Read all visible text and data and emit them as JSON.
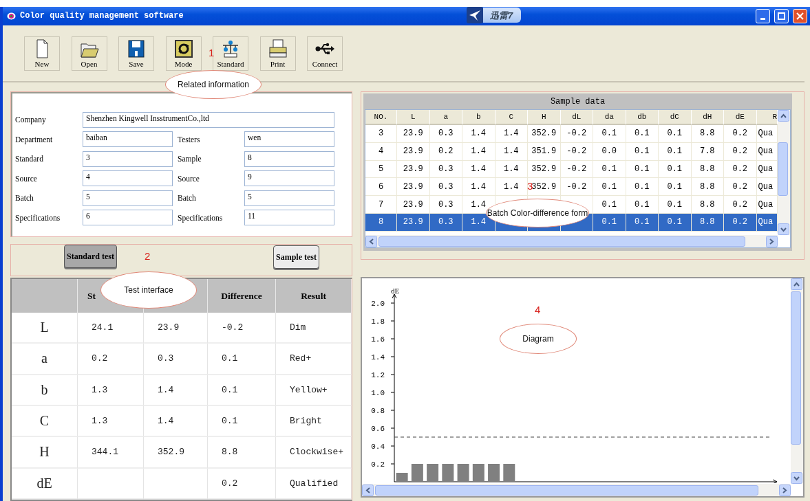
{
  "window": {
    "title": "Color quality management software"
  },
  "title_badge": {
    "label": "迅雷7"
  },
  "toolbar": [
    {
      "kind": "new",
      "label": "New"
    },
    {
      "kind": "open",
      "label": "Open"
    },
    {
      "kind": "save",
      "label": "Save"
    },
    {
      "kind": "mode",
      "label": "Mode"
    },
    {
      "kind": "standard",
      "label": "Standard"
    },
    {
      "kind": "print",
      "label": "Print"
    },
    {
      "kind": "connect",
      "label": "Connect"
    }
  ],
  "info": {
    "rows": [
      [
        {
          "label": "Company",
          "value": "Shenzhen Kingwell InsstrumentCo.,ltd"
        }
      ],
      [
        {
          "label": "Department",
          "value": "baiban"
        },
        {
          "label": "Testers",
          "value": "wen"
        }
      ],
      [
        {
          "label": "Standard",
          "value": "3"
        },
        {
          "label": "Sample",
          "value": "8"
        }
      ],
      [
        {
          "label": "Source",
          "value": "4"
        },
        {
          "label": "Source",
          "value": "9"
        }
      ],
      [
        {
          "label": "Batch",
          "value": "5"
        },
        {
          "label": "Batch",
          "value": "5"
        }
      ],
      [
        {
          "label": "Specifications",
          "value": "6"
        },
        {
          "label": "Specifications",
          "value": "11"
        }
      ]
    ]
  },
  "test_buttons": [
    {
      "label": "Standard test",
      "selected": true
    },
    {
      "label": "Sample test",
      "selected": false
    }
  ],
  "test_table": {
    "columns": [
      {
        "kind": "blank"
      },
      {
        "kind": "text",
        "label": "St"
      },
      {
        "kind": "blank"
      },
      {
        "kind": "text",
        "label": "Difference"
      },
      {
        "kind": "text",
        "label": "Result"
      }
    ],
    "rows": [
      [
        "L",
        "24.1",
        "23.9",
        "-0.2",
        "Dim"
      ],
      [
        "a",
        "0.2",
        "0.3",
        "0.1",
        "Red+"
      ],
      [
        "b",
        "1.3",
        "1.4",
        "0.1",
        "Yellow+"
      ],
      [
        "C",
        "1.3",
        "1.4",
        "0.1",
        "Bright"
      ],
      [
        "H",
        "344.1",
        "352.9",
        "8.8",
        "Clockwise+"
      ],
      [
        "dE",
        null,
        null,
        "0.2",
        "Qualified"
      ]
    ]
  },
  "sample_data": {
    "title": "Sample data",
    "columns": [
      "NO.",
      "L",
      "a",
      "b",
      "C",
      "H",
      "dL",
      "da",
      "db",
      "dC",
      "dH",
      "dE",
      "R"
    ],
    "rows": [
      {
        "selected": false,
        "cells": [
          "3",
          "23.9",
          "0.3",
          "1.4",
          "1.4",
          "352.9",
          "-0.2",
          "0.1",
          "0.1",
          "0.1",
          "8.8",
          "0.2",
          "Qua"
        ]
      },
      {
        "selected": false,
        "cells": [
          "4",
          "23.9",
          "0.2",
          "1.4",
          "1.4",
          "351.9",
          "-0.2",
          "0.0",
          "0.1",
          "0.1",
          "7.8",
          "0.2",
          "Qua"
        ]
      },
      {
        "selected": false,
        "cells": [
          "5",
          "23.9",
          "0.3",
          "1.4",
          "1.4",
          "352.9",
          "-0.2",
          "0.1",
          "0.1",
          "0.1",
          "8.8",
          "0.2",
          "Qua"
        ]
      },
      {
        "selected": false,
        "cells": [
          "6",
          "23.9",
          "0.3",
          "1.4",
          "1.4",
          "352.9",
          "-0.2",
          "0.1",
          "0.1",
          "0.1",
          "8.8",
          "0.2",
          "Qua"
        ]
      },
      {
        "selected": false,
        "cells": [
          "7",
          "23.9",
          "0.3",
          "1.4",
          null,
          null,
          null,
          "0.1",
          "0.1",
          "0.1",
          "8.8",
          "0.2",
          "Qua"
        ]
      },
      {
        "selected": true,
        "cells": [
          "8",
          "23.9",
          "0.3",
          "1.4",
          null,
          null,
          null,
          "0.1",
          "0.1",
          "0.1",
          "8.8",
          "0.2",
          "Qua"
        ]
      }
    ]
  },
  "diagram": {
    "chart_data": {
      "type": "bar",
      "ylabel": "dE",
      "categories": [
        null,
        null,
        null,
        null,
        null,
        null,
        null,
        null,
        null,
        null,
        null,
        null,
        null,
        null,
        null,
        null,
        null,
        null,
        null,
        null,
        null,
        null,
        null,
        null,
        null
      ],
      "values": [
        0.1,
        0.2,
        0.2,
        0.2,
        0.2,
        0.2,
        0.2,
        0.2,
        null,
        null,
        null,
        null,
        null,
        null,
        null,
        null,
        null,
        null,
        null,
        null,
        null,
        null,
        null,
        null,
        null
      ],
      "ylim": [
        0,
        2.1
      ],
      "yticks": [
        {
          "value": 0.2,
          "label": "0.2"
        },
        {
          "value": 0.4,
          "label": "0.4"
        },
        {
          "value": 0.6,
          "label": "0.6"
        },
        {
          "value": 0.8,
          "label": "0.8"
        },
        {
          "value": 1.0,
          "label": "1.0"
        },
        {
          "value": 1.2,
          "label": "1.2"
        },
        {
          "value": 1.4,
          "label": "1.4"
        },
        {
          "value": 1.6,
          "label": "1.6"
        },
        {
          "value": 1.8,
          "label": "1.8"
        },
        {
          "value": 2.0,
          "label": "2.0"
        }
      ],
      "ref_lines": [
        {
          "axis": "y",
          "value": 0.5
        }
      ]
    }
  },
  "callouts": [
    {
      "number": "1",
      "label": "Related information"
    },
    {
      "number": "2",
      "label": "Test interface"
    },
    {
      "number": "3",
      "label": "Batch Color-difference form"
    },
    {
      "number": "4",
      "label": "Diagram"
    }
  ]
}
